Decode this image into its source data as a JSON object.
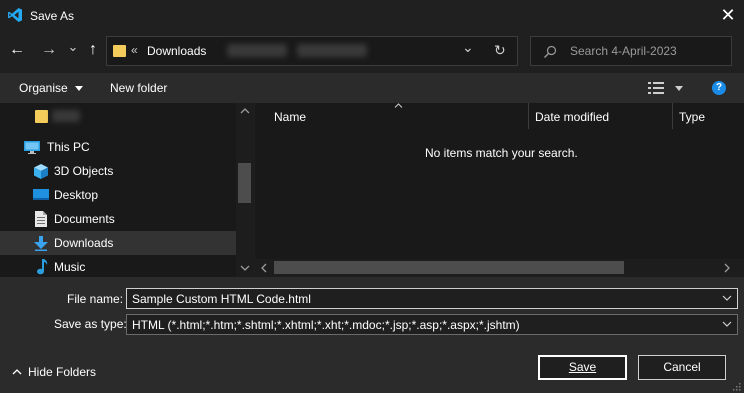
{
  "window": {
    "title": "Save As",
    "close_glyph": "✕"
  },
  "nav": {
    "back_glyph": "←",
    "forward_glyph": "→",
    "recent_glyph": "⌄",
    "up_glyph": "↑",
    "address_overflow": "«",
    "address_folder": "Downloads",
    "address_dropdown_glyph": "⌄",
    "refresh_glyph": "↻",
    "search_placeholder": "Search 4-April-2023"
  },
  "toolbar": {
    "organise_label": "Organise",
    "new_folder_label": "New folder",
    "help_glyph": "?"
  },
  "tree": {
    "items": [
      {
        "label": "",
        "icon": "folder-icon"
      },
      {
        "label": "This PC",
        "icon": "monitor-icon"
      },
      {
        "label": "3D Objects",
        "icon": "cube-icon"
      },
      {
        "label": "Desktop",
        "icon": "desktop-icon"
      },
      {
        "label": "Documents",
        "icon": "document-icon"
      },
      {
        "label": "Downloads",
        "icon": "download-icon",
        "selected": true
      },
      {
        "label": "Music",
        "icon": "music-icon"
      }
    ]
  },
  "filelist": {
    "columns": [
      "Name",
      "Date modified",
      "Type"
    ],
    "empty_message": "No items match your search."
  },
  "bottom": {
    "file_name_label": "File name:",
    "file_name_value": "Sample Custom HTML Code.html",
    "save_type_label": "Save as type:",
    "save_type_value": "HTML (*.html;*.htm;*.shtml;*.xhtml;*.xht;*.mdoc;*.jsp;*.asp;*.aspx;*.jshtm)",
    "hide_folders_label": "Hide Folders",
    "save_label": "Save",
    "cancel_label": "Cancel"
  },
  "colors": {
    "accent_blue": "#1a8ce8",
    "folder_yellow": "#f4cc5b",
    "background": "#1f1f1f"
  }
}
